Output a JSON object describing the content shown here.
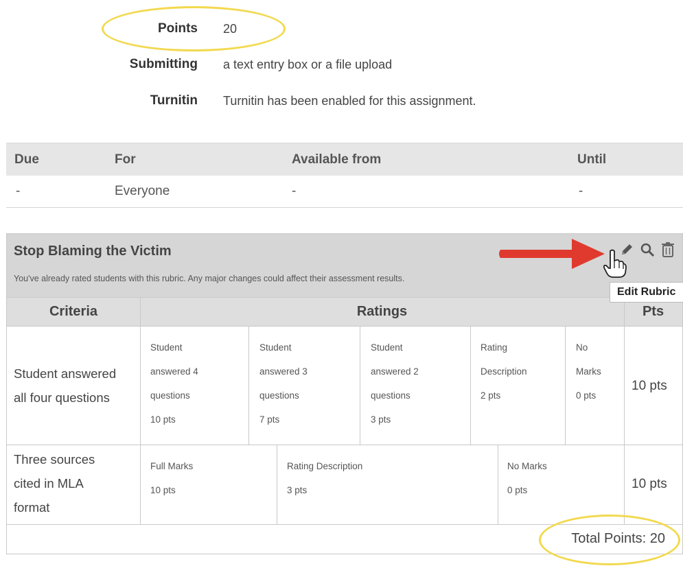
{
  "details": {
    "points_label": "Points",
    "points_value": "20",
    "submitting_label": "Submitting",
    "submitting_value": "a text entry box or a file upload",
    "turnitin_label": "Turnitin",
    "turnitin_value": "Turnitin has been enabled for this assignment."
  },
  "due_table": {
    "headers": [
      "Due",
      "For",
      "Available from",
      "Until"
    ],
    "row": [
      "-",
      "Everyone",
      "-",
      "-"
    ]
  },
  "rubric": {
    "title": "Stop Blaming the Victim",
    "warning": "You've already rated students with this rubric. Any major changes could affect their assessment results.",
    "tooltip": "Edit Rubric",
    "icons": [
      "pencil-icon",
      "magnifier-icon",
      "trash-icon"
    ],
    "headers": {
      "criteria": "Criteria",
      "ratings": "Ratings",
      "pts": "Pts"
    },
    "criteria": [
      {
        "description": [
          "Student answered",
          "all four questions"
        ],
        "ratings": [
          {
            "lines": [
              "Student",
              "answered 4",
              "questions"
            ],
            "pts": "10 pts"
          },
          {
            "lines": [
              "Student",
              "answered 3",
              "questions"
            ],
            "pts": "7 pts"
          },
          {
            "lines": [
              "Student",
              "answered 2",
              "questions"
            ],
            "pts": "3 pts"
          },
          {
            "lines": [
              "Rating",
              "Description"
            ],
            "pts": "2 pts"
          },
          {
            "lines": [
              "No",
              "Marks"
            ],
            "pts": "0 pts"
          }
        ],
        "points": "10 pts"
      },
      {
        "description": [
          "Three sources",
          "cited in MLA",
          "format"
        ],
        "ratings": [
          {
            "lines": [
              "Full Marks"
            ],
            "pts": "10 pts"
          },
          {
            "lines": [
              "Rating Description"
            ],
            "pts": "3 pts"
          },
          {
            "lines": [
              "No Marks"
            ],
            "pts": "0 pts"
          }
        ],
        "points": "10 pts"
      }
    ],
    "total": "Total Points: 20"
  },
  "colors": {
    "highlight": "#f2d94e",
    "arrow": "#e03a2e",
    "header_bg": "#d6d6d6"
  }
}
